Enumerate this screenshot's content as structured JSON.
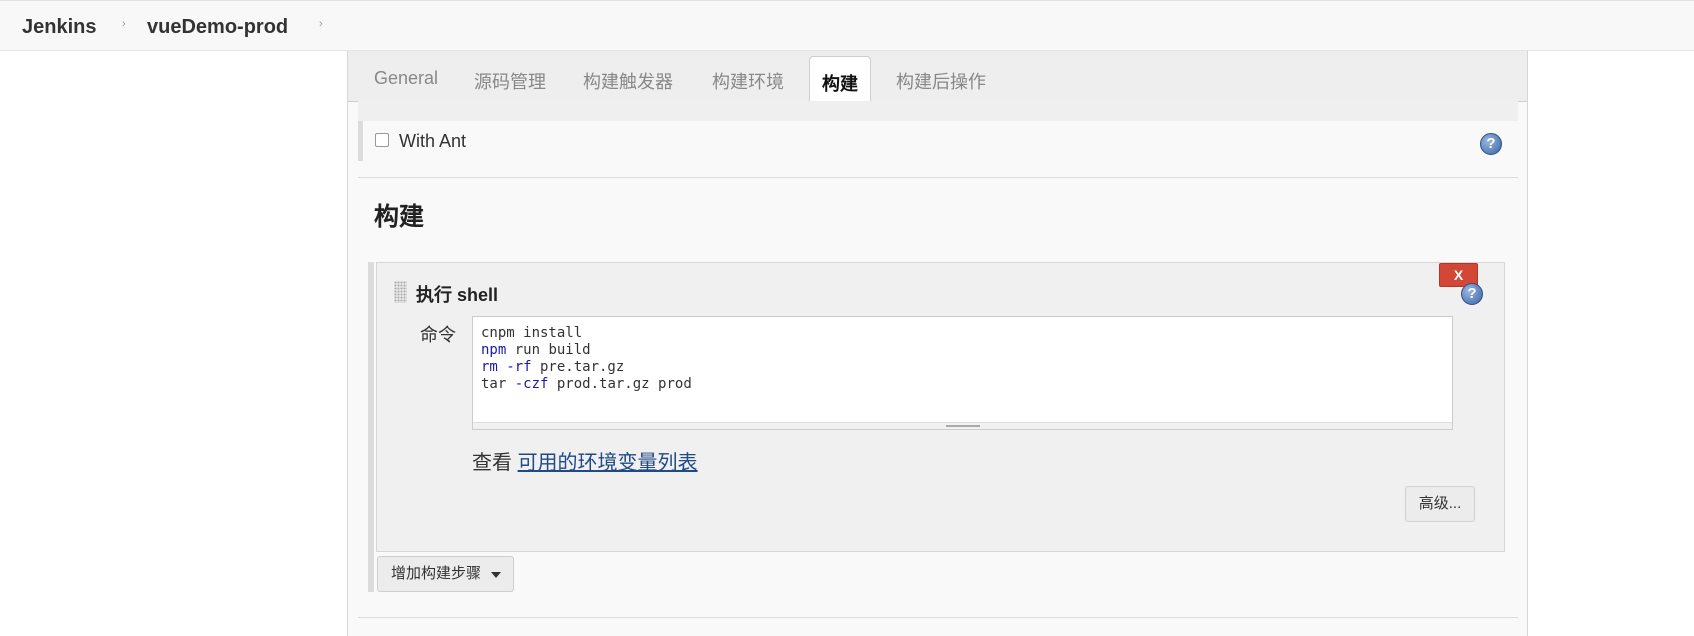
{
  "breadcrumb": {
    "items": [
      "Jenkins",
      "vueDemo-prod"
    ],
    "separator": "›"
  },
  "tabs": [
    {
      "label": "General",
      "active": false
    },
    {
      "label": "源码管理",
      "active": false
    },
    {
      "label": "构建触发器",
      "active": false
    },
    {
      "label": "构建环境",
      "active": false
    },
    {
      "label": "构建",
      "active": true
    },
    {
      "label": "构建后操作",
      "active": false
    }
  ],
  "build_env": {
    "with_ant_label": "With Ant",
    "with_ant_checked": false
  },
  "build_section": {
    "title": "构建",
    "step": {
      "title": "执行 shell",
      "delete_label": "X",
      "command_label": "命令",
      "command_lines": [
        {
          "cmd": "cnpm",
          "args": " install"
        },
        {
          "cmd": "npm",
          "args": " run build"
        },
        {
          "cmd": "rm",
          "flag": " -rf",
          "args": " pre.tar.gz"
        },
        {
          "cmd": "tar",
          "flag": " -czf",
          "args": " prod.tar.gz prod"
        }
      ],
      "env_prefix": "查看",
      "env_link": "可用的环境变量列表",
      "advanced_label": "高级..."
    },
    "add_step_label": "增加构建步骤"
  },
  "icons": {
    "help": "?"
  },
  "colors": {
    "delete_button": "#d24736",
    "link": "#204a87",
    "keyword": "#1a1aa6"
  }
}
